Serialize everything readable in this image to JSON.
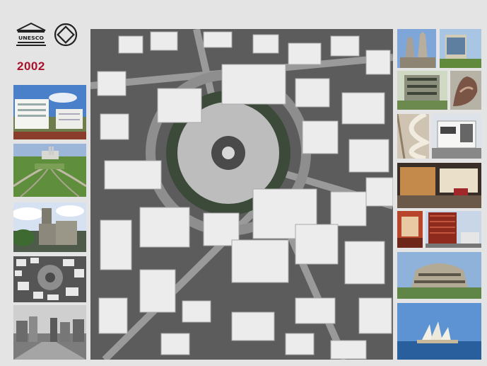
{
  "header": {
    "unesco_logo_text": "UNESCO",
    "year": "2002"
  },
  "colors": {
    "background": "#e4e4e4",
    "year_accent": "#a8122a"
  },
  "left_thumbnails": [
    {
      "icon": "white-modernist-building-photo"
    },
    {
      "icon": "brasilia-aerial-photo"
    },
    {
      "icon": "church-tower-photo"
    },
    {
      "icon": "tel-aviv-aerial-thumb-photo"
    },
    {
      "icon": "city-skyline-bw-photo"
    }
  ],
  "main_photo": {
    "icon": "tel-aviv-dizengoff-square-aerial-photo"
  },
  "right_thumbnails": [
    {
      "icon": "gaudi-church-photo"
    },
    {
      "icon": "modern-campus-building-photo"
    },
    {
      "icon": "bauhaus-building-photo"
    },
    {
      "icon": "sculpture-photo"
    },
    {
      "icon": "spiral-staircase-photo"
    },
    {
      "icon": "white-villa-photo"
    },
    {
      "icon": "interior-lounge-photo"
    },
    {
      "icon": "red-interior-photo"
    },
    {
      "icon": "red-tower-photo"
    },
    {
      "icon": "centennial-hall-photo"
    },
    {
      "icon": "sydney-opera-house-photo"
    }
  ]
}
